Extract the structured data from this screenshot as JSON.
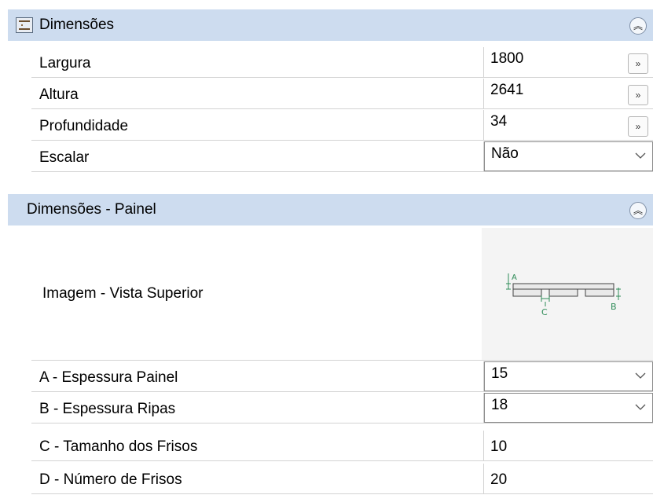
{
  "sections": {
    "dimensoes": {
      "title": "Dimensões",
      "rows": [
        {
          "label": "Largura",
          "value": "1800",
          "button": "»"
        },
        {
          "label": "Altura",
          "value": "2641",
          "button": "»"
        },
        {
          "label": "Profundidade",
          "value": "34",
          "button": "»"
        },
        {
          "label": "Escalar",
          "value": "Não"
        }
      ]
    },
    "painel": {
      "title": "Dimensões - Painel",
      "image_label": "Imagem - Vista Superior",
      "diagram_labels": {
        "a": "A",
        "b": "B",
        "c": "C"
      },
      "rows": [
        {
          "label": "A - Espessura Painel",
          "value": "15"
        },
        {
          "label": "B - Espessura Ripas",
          "value": "18"
        },
        {
          "label": "C - Tamanho dos Frisos",
          "value": "10"
        },
        {
          "label": "D - Número de Frisos",
          "value": "20"
        }
      ]
    }
  },
  "collapse_icon": "double-chevron-up",
  "colors": {
    "header_bg": "#cddcef",
    "diagram": "#2e8b57"
  }
}
